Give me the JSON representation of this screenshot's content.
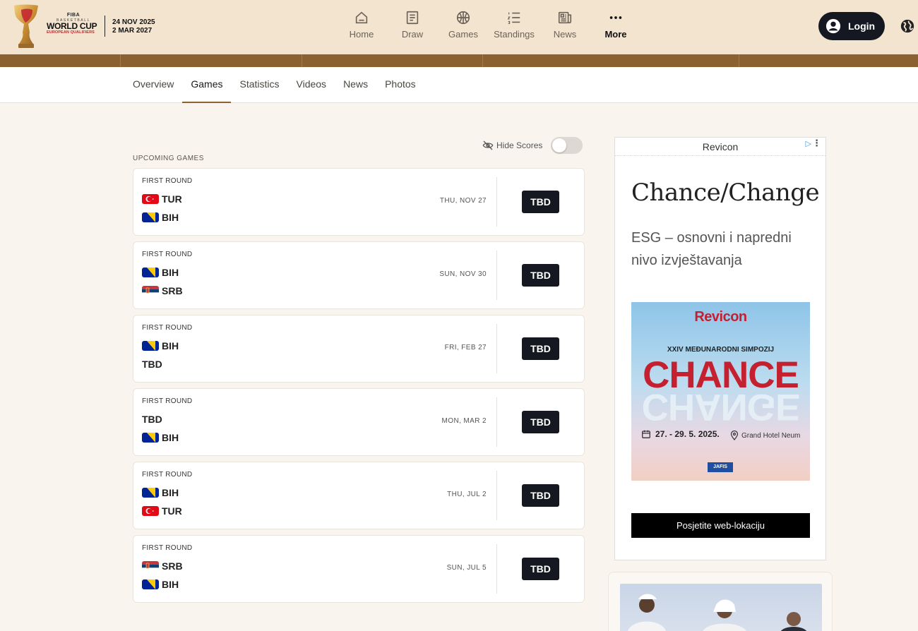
{
  "header": {
    "brand": {
      "fiba": "FIBA",
      "basketball": "BASKETBALL",
      "world_cup": "WORLD CUP",
      "qualifiers": "EUROPEAN QUALIFIERS"
    },
    "dates": [
      "24 NOV 2025",
      "2 MAR 2027"
    ],
    "nav": [
      {
        "label": "Home",
        "icon": "home-icon"
      },
      {
        "label": "Draw",
        "icon": "draw-icon"
      },
      {
        "label": "Games",
        "icon": "basketball-icon"
      },
      {
        "label": "Standings",
        "icon": "standings-icon"
      },
      {
        "label": "News",
        "icon": "news-icon"
      },
      {
        "label": "More",
        "icon": "more-dots-icon"
      }
    ],
    "login_label": "Login"
  },
  "subnav": {
    "tabs": [
      "Overview",
      "Games",
      "Statistics",
      "Videos",
      "News",
      "Photos"
    ],
    "active": "Games"
  },
  "controls": {
    "hide_scores_label": "Hide Scores",
    "hide_scores_on": false
  },
  "section_title": "UPCOMING GAMES",
  "games": [
    {
      "round": "FIRST ROUND",
      "team1": "TUR",
      "flag1": "tur",
      "team2": "BIH",
      "flag2": "bih",
      "date": "THU, NOV 27",
      "status": "TBD"
    },
    {
      "round": "FIRST ROUND",
      "team1": "BIH",
      "flag1": "bih",
      "team2": "SRB",
      "flag2": "srb",
      "date": "SUN, NOV 30",
      "status": "TBD"
    },
    {
      "round": "FIRST ROUND",
      "team1": "BIH",
      "flag1": "bih",
      "team2": "TBD",
      "flag2": "",
      "date": "FRI, FEB 27",
      "status": "TBD"
    },
    {
      "round": "FIRST ROUND",
      "team1": "TBD",
      "flag1": "",
      "team2": "BIH",
      "flag2": "bih",
      "date": "MON, MAR 2",
      "status": "TBD"
    },
    {
      "round": "FIRST ROUND",
      "team1": "BIH",
      "flag1": "bih",
      "team2": "TUR",
      "flag2": "tur",
      "date": "THU, JUL 2",
      "status": "TBD"
    },
    {
      "round": "FIRST ROUND",
      "team1": "SRB",
      "flag1": "srb",
      "team2": "BIH",
      "flag2": "bih",
      "date": "SUN, JUL 5",
      "status": "TBD"
    }
  ],
  "ad": {
    "advertiser": "Revicon",
    "headline": "Chance/Change",
    "body": "ESG – osnovni i napredni nivo izvještavanja",
    "image": {
      "brand": "Revicon",
      "symposium": "XXIV MEĐUNARODNI SIMPOZIJ",
      "word": "CHANCE",
      "mirror_word": "CHANGE",
      "dates": "27. - 29. 5. 2025.",
      "venue": "Grand Hotel Neum",
      "sponsor": "JAFIS"
    },
    "cta": "Posjetite web-lokaciju"
  },
  "colors": {
    "header_bg": "#f3e4d0",
    "stripe": "#8b6131",
    "dark_button": "#151821",
    "page_bg": "#f9f5ee",
    "ad_red": "#c42030"
  }
}
